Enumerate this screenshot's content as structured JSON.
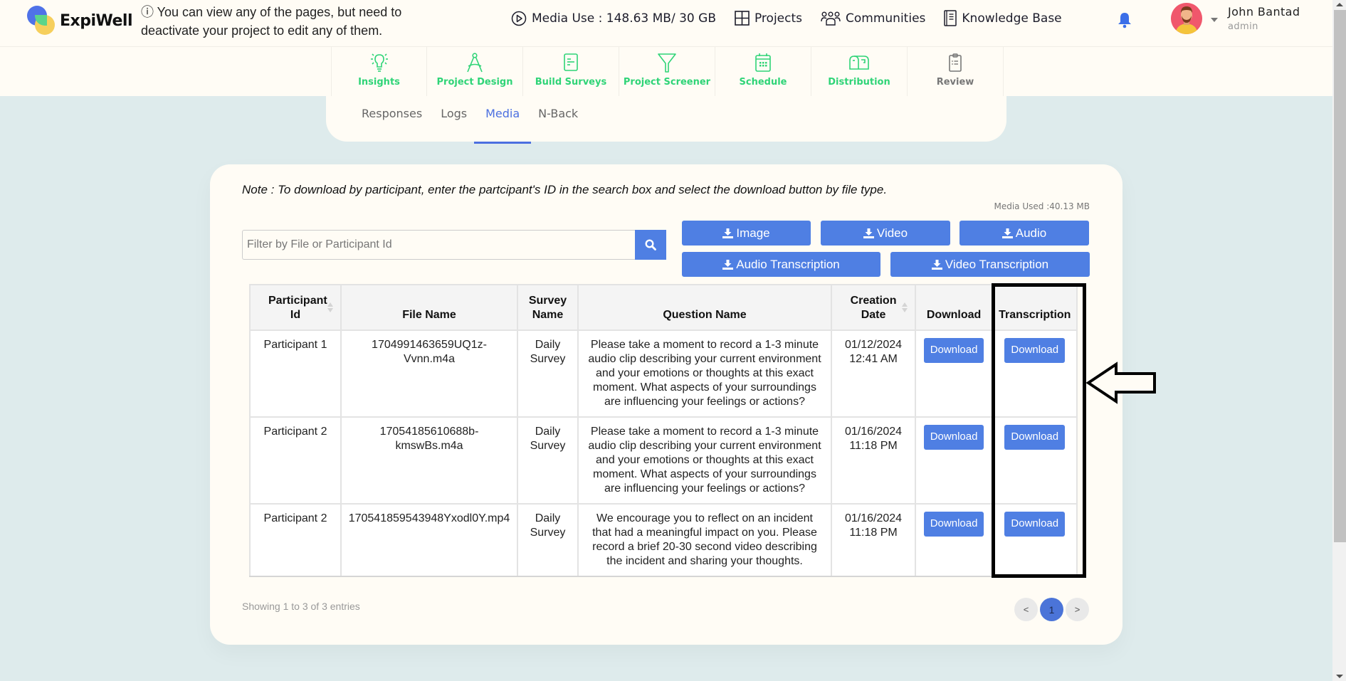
{
  "header": {
    "brand": "ExpiWell",
    "notice": "ⓘ You can view any of the pages, but need to deactivate your project to edit any of them.",
    "nav": [
      {
        "label": "Media Use : 148.63 MB/ 30 GB",
        "icon": "play-circle-icon"
      },
      {
        "label": "Projects",
        "icon": "grid-icon"
      },
      {
        "label": "Communities",
        "icon": "people-icon"
      },
      {
        "label": "Knowledge Base",
        "icon": "book-icon"
      }
    ],
    "notification_icon": "bell-icon",
    "user": {
      "name": "John Bantad",
      "role": "admin"
    }
  },
  "steps": [
    {
      "label": "Insights",
      "icon": "lightbulb-icon"
    },
    {
      "label": "Project Design",
      "icon": "compass-icon"
    },
    {
      "label": "Build Surveys",
      "icon": "survey-form-icon"
    },
    {
      "label": "Project Screener",
      "icon": "filter-icon"
    },
    {
      "label": "Schedule",
      "icon": "calendar-icon"
    },
    {
      "label": "Distribution",
      "icon": "mailbox-icon"
    },
    {
      "label": "Review",
      "icon": "clipboard-icon"
    }
  ],
  "tabs": [
    {
      "label": "Responses",
      "active": false
    },
    {
      "label": "Logs",
      "active": false
    },
    {
      "label": "Media",
      "active": true
    },
    {
      "label": "N-Back",
      "active": false
    }
  ],
  "media": {
    "note": "Note : To download by participant, enter the partcipant's ID in the search box and select the download button by file type.",
    "media_used": "Media Used :40.13 MB",
    "search": {
      "placeholder": "Filter by File or Participant Id",
      "value": ""
    },
    "download_buttons": [
      "Image",
      "Video",
      "Audio",
      "Audio Transcription",
      "Video Transcription"
    ],
    "table": {
      "columns": [
        "Participant Id",
        "File Name",
        "Survey Name",
        "Question Name",
        "Creation Date",
        "Download",
        "Transcription"
      ],
      "rows": [
        {
          "participant": "Participant 1",
          "file": "1704991463659UQ1z-Vvnn.m4a",
          "survey": "Daily Survey",
          "question": "Please take a moment to record a 1-3 minute audio clip describing your current environment and your emotions or thoughts at this exact moment. What aspects of your surroundings are influencing your feelings or actions?",
          "date": "01/12/2024 12:41 AM",
          "download": "Download",
          "transcription": "Download"
        },
        {
          "participant": "Participant 2",
          "file": "17054185610688b-kmswBs.m4a",
          "survey": "Daily Survey",
          "question": "Please take a moment to record a 1-3 minute audio clip describing your current environment and your emotions or thoughts at this exact moment. What aspects of your surroundings are influencing your feelings or actions?",
          "date": "01/16/2024 11:18 PM",
          "download": "Download",
          "transcription": "Download"
        },
        {
          "participant": "Participant 2",
          "file": "170541859543948Yxodl0Y.mp4",
          "survey": "Daily Survey",
          "question": "We encourage you to reflect on an incident that had a meaningful impact on you. Please record a brief 20-30 second video describing the incident and sharing your thoughts.",
          "date": "01/16/2024 11:18 PM",
          "download": "Download",
          "transcription": "Download"
        }
      ]
    },
    "showing": "Showing 1 to 3 of 3 entries",
    "pagination": {
      "prev": "<",
      "current": "1",
      "next": ">"
    }
  },
  "colors": {
    "accent_blue": "#4f7fe3",
    "step_green": "#2fd477",
    "page_bg": "#deebec",
    "card_bg": "#fffcf5"
  }
}
